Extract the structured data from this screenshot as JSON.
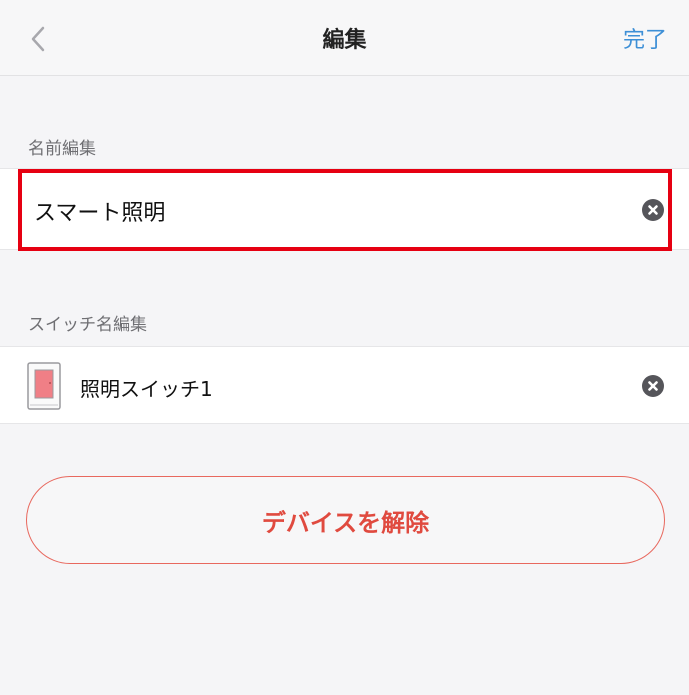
{
  "header": {
    "title": "編集",
    "done_label": "完了"
  },
  "name_section": {
    "label": "名前編集",
    "value": "スマート照明"
  },
  "switch_section": {
    "label": "スイッチ名編集",
    "switch_name": "照明スイッチ1"
  },
  "remove_button_label": "デバイスを解除",
  "colors": {
    "accent_blue": "#3d8fd6",
    "danger_red": "#e04a3f",
    "highlight_red": "#e60012",
    "device_pink": "#f07f86"
  },
  "icons": [
    "chevron-left-icon",
    "clear-icon",
    "switch-device-icon"
  ]
}
